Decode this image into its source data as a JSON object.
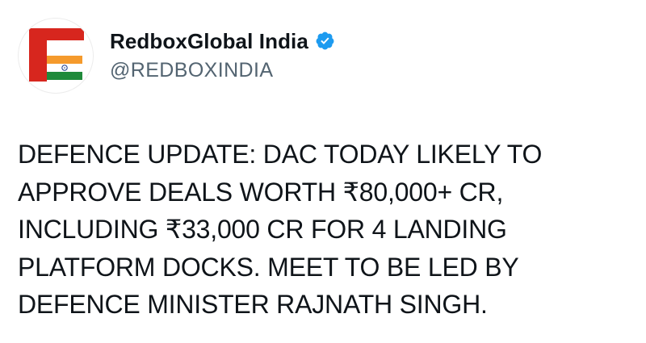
{
  "account": {
    "display_name": "RedboxGlobal India",
    "handle": "@REDBOXINDIA",
    "verified": true,
    "avatar_icon": "redbox-india-flag-logo-icon",
    "verified_icon": "verified-badge-icon"
  },
  "post": {
    "text": "DEFENCE UPDATE: DAC TODAY LIKELY TO\nAPPROVE DEALS WORTH ₹80,000+ CR,\nINCLUDING ₹33,000 CR FOR 4 LANDING\nPLATFORM DOCKS. MEET TO BE LED BY\nDEFENCE MINISTER RAJNATH SINGH."
  },
  "colors": {
    "brand_red": "#d7261e",
    "saffron": "#f59a2c",
    "india_green": "#1f8a3a",
    "verified_blue": "#1d9bf0",
    "handle_gray": "#536471",
    "text_dark": "#0f1419"
  }
}
